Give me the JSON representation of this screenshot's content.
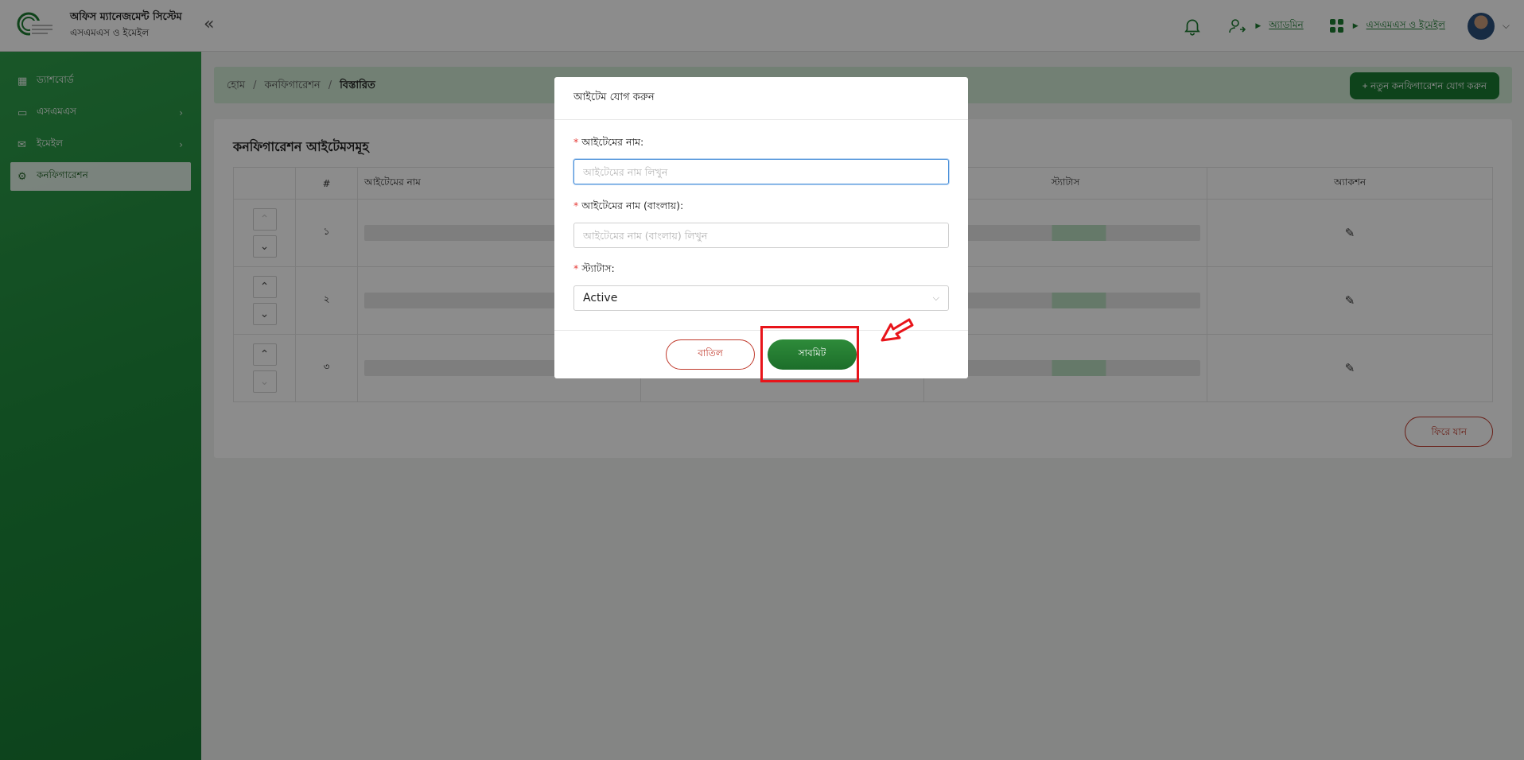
{
  "header": {
    "app_title": "অফিস ম্যানেজমেন্ট সিস্টেম",
    "app_subtitle": "এসএমএস ও ইমেইল",
    "collapse_glyph": "«",
    "user_label": "অ্যাডমিন",
    "module_label": "এসএমএস ও ইমেইল"
  },
  "sidebar": {
    "items": [
      {
        "label": "ড্যাশবোর্ড",
        "icon": "dashboard-icon"
      },
      {
        "label": "এসএমএস",
        "icon": "message-icon"
      },
      {
        "label": "ইমেইল",
        "icon": "mail-icon"
      },
      {
        "label": "কনফিগারেশন",
        "icon": "settings-icon"
      }
    ]
  },
  "breadcrumb": {
    "home": "হোম",
    "section": "কনফিগারেশন",
    "current": "বিস্তারিত"
  },
  "new_config_button": "+ নতুন কনফিগারেশন যোগ করুন",
  "card": {
    "title": "কনফিগারেশন আইটেমসমূহ",
    "columns": [
      "#",
      "আইটেমের নাম",
      "স্ট্যাটাস",
      "অ্যাকশন"
    ],
    "rows": [
      {
        "index": "১"
      },
      {
        "index": "২"
      },
      {
        "index": "৩"
      }
    ],
    "back_button": "ফিরে যান"
  },
  "modal": {
    "title": "আইটেম যোগ করুন",
    "name_label": "আইটেমের নাম:",
    "name_placeholder": "আইটেমের নাম লিখুন",
    "name_bn_label": "আইটেমের নাম (বাংলায়):",
    "name_bn_placeholder": "আইটেমের নাম (বাংলায়) লিখুন",
    "status_label": "স্ট্যাটাস:",
    "status_value": "Active",
    "required_mark": "*",
    "cancel_button": "বাতিল",
    "submit_button": "সাবমিট"
  },
  "colors": {
    "primary": "#1a7a32",
    "sidebar": "#1f8a3c",
    "danger": "#c0392b",
    "highlight": "#e8141a"
  }
}
